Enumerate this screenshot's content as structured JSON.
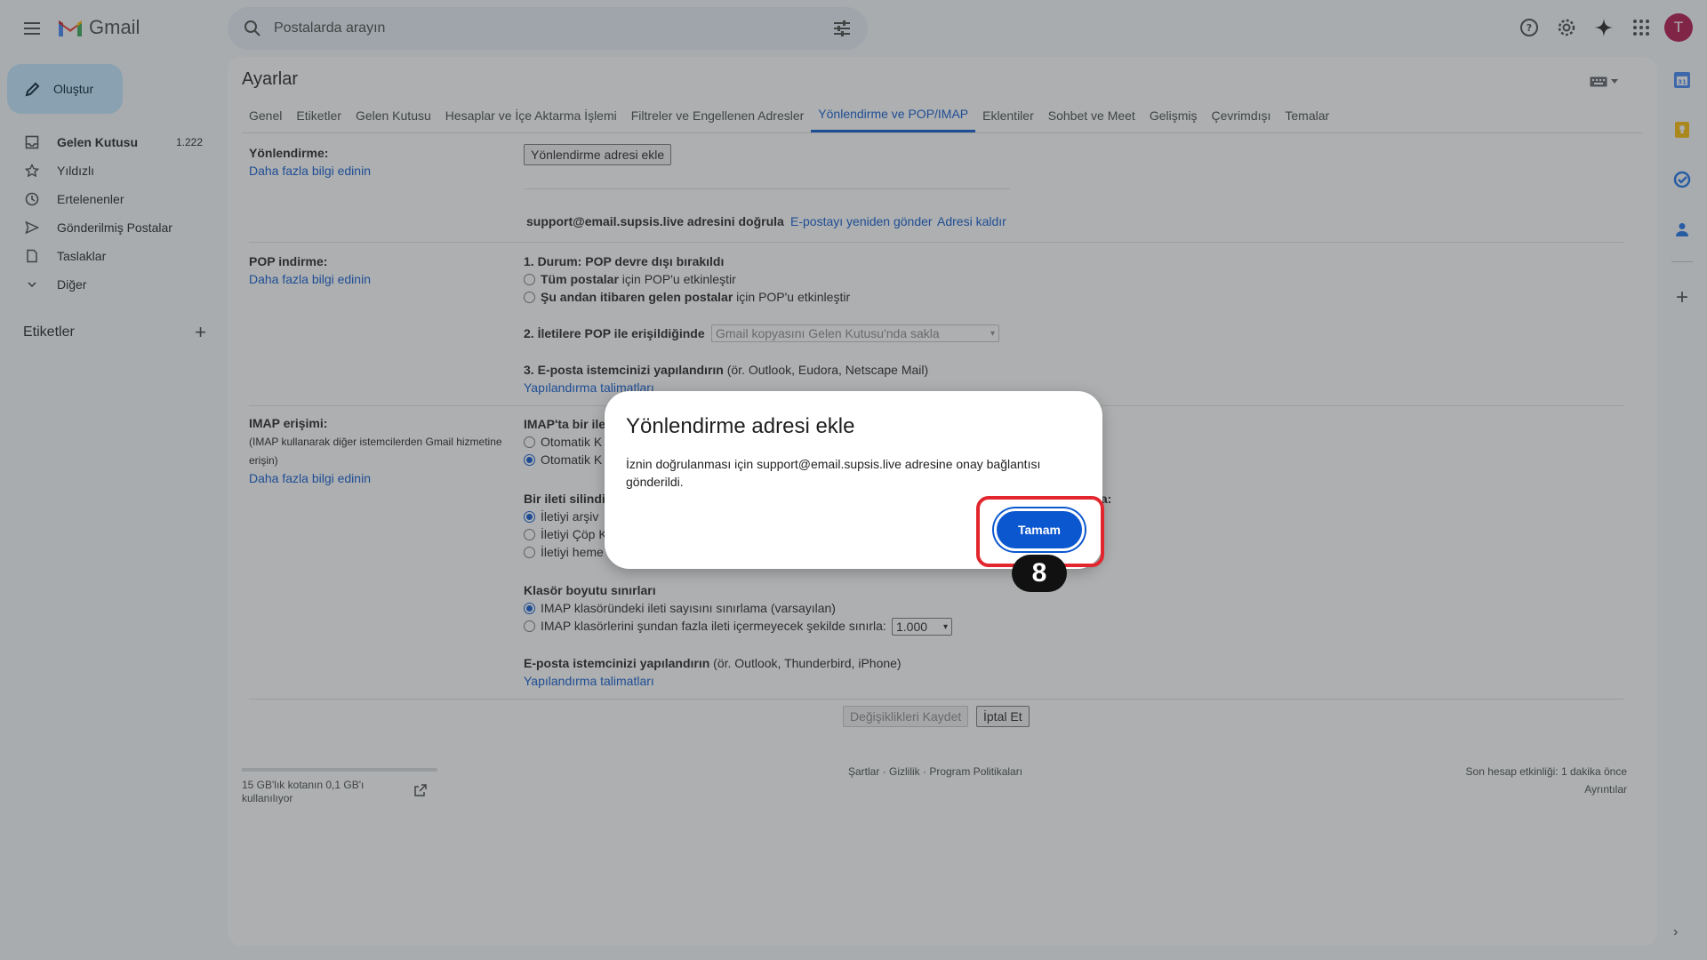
{
  "header": {
    "app_name": "Gmail",
    "search_placeholder": "Postalarda arayın",
    "avatar_letter": "T"
  },
  "compose": {
    "label": "Oluştur"
  },
  "nav": {
    "items": [
      {
        "label": "Gelen Kutusu",
        "count": "1.222",
        "icon": "inbox-icon"
      },
      {
        "label": "Yıldızlı",
        "icon": "star-icon"
      },
      {
        "label": "Ertelenenler",
        "icon": "clock-icon"
      },
      {
        "label": "Gönderilmiş Postalar",
        "icon": "send-icon"
      },
      {
        "label": "Taslaklar",
        "icon": "draft-icon"
      },
      {
        "label": "Diğer",
        "icon": "chevron-down-icon"
      }
    ],
    "labels_heading": "Etiketler"
  },
  "settings": {
    "title": "Ayarlar",
    "tabs": [
      "Genel",
      "Etiketler",
      "Gelen Kutusu",
      "Hesaplar ve İçe Aktarma İşlemi",
      "Filtreler ve Engellenen Adresler",
      "Yönlendirme ve POP/IMAP",
      "Eklentiler",
      "Sohbet ve Meet",
      "Gelişmiş",
      "Çevrimdışı",
      "Temalar"
    ],
    "active_tab": "Yönlendirme ve POP/IMAP",
    "forwarding": {
      "label": "Yönlendirme:",
      "learn_more": "Daha fazla bilgi edinin",
      "add_button": "Yönlendirme adresi ekle",
      "verify_text": "support@email.supsis.live adresini doğrula",
      "resend_link": "E-postayı yeniden gönder",
      "remove_link": "Adresi kaldır"
    },
    "pop": {
      "label": "POP indirme:",
      "learn_more": "Daha fazla bilgi edinin",
      "status": "1. Durum: POP devre dışı bırakıldı",
      "option1_bold": "Tüm postalar",
      "option1_rest": " için POP'u etkinleştir",
      "option2_bold": "Şu andan itibaren gelen postalar",
      "option2_rest": " için POP'u etkinleştir",
      "access_label": "2. İletilere POP ile erişildiğinde",
      "access_select": "Gmail kopyasını Gelen Kutusu'nda sakla",
      "client_bold": "3. E-posta istemcinizi yapılandırın",
      "client_rest": " (ör. Outlook, Eudora, Netscape Mail)",
      "config_link": "Yapılandırma talimatları"
    },
    "imap": {
      "label": "IMAP erişimi:",
      "desc": "(IMAP kullanarak diğer istemcilerden Gmail hizmetine erişin)",
      "learn_more": "Daha fazla bilgi edinin",
      "status_partial": "IMAP'ta bir ile",
      "auto1": "Otomatik K",
      "auto2": "Otomatik K",
      "delete_partial": "Bir ileti silindi",
      "delete_tail": "la:",
      "del_opt1": "İletiyi arşiv",
      "del_opt2": "İletiyi Çöp K",
      "del_opt3": "İletiyi heme",
      "folder_limits": "Klasör boyutu sınırları",
      "folder_opt1": "IMAP klasöründeki ileti sayısını sınırlama (varsayılan)",
      "folder_opt2": "IMAP klasörlerini şundan fazla ileti içermeyecek şekilde sınırla:",
      "folder_select": "1.000",
      "client_bold": "E-posta istemcinizi yapılandırın",
      "client_rest": " (ör. Outlook, Thunderbird, iPhone)",
      "config_link": "Yapılandırma talimatları"
    },
    "save_button": "Değişiklikleri Kaydet",
    "cancel_button": "İptal Et"
  },
  "footer": {
    "quota": "15 GB'lık kotanın 0,1 GB'ı kullanılıyor",
    "links": "Şartlar · Gizlilik · Program Politikaları",
    "activity": "Son hesap etkinliği: 1 dakika önce",
    "details": "Ayrıntılar"
  },
  "dialog": {
    "title": "Yönlendirme adresi ekle",
    "body": "İznin doğrulanması için support@email.supsis.live adresine onay bağlantısı gönderildi.",
    "ok_button": "Tamam",
    "step_number": "8"
  },
  "colors": {
    "accent": "#0b57d0",
    "highlight_ring": "#e3262d",
    "avatar": "#b3124b",
    "compose_bg": "#c2e7ff"
  }
}
